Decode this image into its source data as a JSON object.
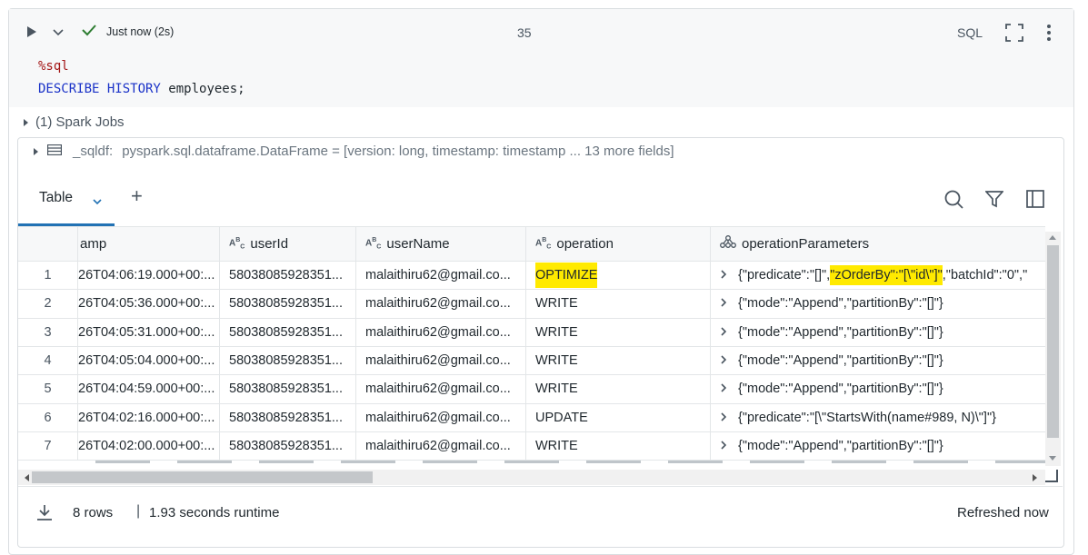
{
  "cell": {
    "status": "Just now (2s)",
    "cell_number": "35",
    "language": "SQL",
    "code_lines": [
      {
        "parts": [
          {
            "t": "%sql",
            "c": "#a31515"
          }
        ]
      },
      {
        "parts": [
          {
            "t": "DESCRIBE HISTORY ",
            "c": "#1a32c8"
          },
          {
            "t": "employees;",
            "c": "#1f272d"
          }
        ]
      }
    ],
    "spark_jobs": "(1) Spark Jobs"
  },
  "dataframe": {
    "var": "_sqldf:",
    "type_text": "pyspark.sql.dataframe.DataFrame = [version: long, timestamp: timestamp ... 13 more fields]"
  },
  "tabs": {
    "table_label": "Table",
    "add": "+"
  },
  "columns": [
    {
      "label": "amp",
      "type": ""
    },
    {
      "label": "userId",
      "type": "ABC"
    },
    {
      "label": "userName",
      "type": "ABC"
    },
    {
      "label": "operation",
      "type": "ABC"
    },
    {
      "label": "operationParameters",
      "type": "STRUCT"
    }
  ],
  "rows": [
    {
      "n": "1",
      "ts": "26T04:06:19.000+00:...",
      "uid": "58038085928351...",
      "uname": "malaithiru62@gmail.co...",
      "op": "OPTIMIZE",
      "params_parts": [
        {
          "t": "{\"predicate\":\"[]\",",
          "hl": false
        },
        {
          "t": "\"zOrderBy\":\"[\\\"id\\\"]\"",
          "hl": true
        },
        {
          "t": ",\"batchId\":\"0\",\"",
          "hl": false
        }
      ],
      "op_hl": true
    },
    {
      "n": "2",
      "ts": "26T04:05:36.000+00:...",
      "uid": "58038085928351...",
      "uname": "malaithiru62@gmail.co...",
      "op": "WRITE",
      "params_parts": [
        {
          "t": "{\"mode\":\"Append\",\"partitionBy\":\"[]\"}",
          "hl": false
        }
      ],
      "op_hl": false
    },
    {
      "n": "3",
      "ts": "26T04:05:31.000+00:...",
      "uid": "58038085928351...",
      "uname": "malaithiru62@gmail.co...",
      "op": "WRITE",
      "params_parts": [
        {
          "t": "{\"mode\":\"Append\",\"partitionBy\":\"[]\"}",
          "hl": false
        }
      ],
      "op_hl": false
    },
    {
      "n": "4",
      "ts": "26T04:05:04.000+00:...",
      "uid": "58038085928351...",
      "uname": "malaithiru62@gmail.co...",
      "op": "WRITE",
      "params_parts": [
        {
          "t": "{\"mode\":\"Append\",\"partitionBy\":\"[]\"}",
          "hl": false
        }
      ],
      "op_hl": false
    },
    {
      "n": "5",
      "ts": "26T04:04:59.000+00:...",
      "uid": "58038085928351...",
      "uname": "malaithiru62@gmail.co...",
      "op": "WRITE",
      "params_parts": [
        {
          "t": "{\"mode\":\"Append\",\"partitionBy\":\"[]\"}",
          "hl": false
        }
      ],
      "op_hl": false
    },
    {
      "n": "6",
      "ts": "26T04:02:16.000+00:...",
      "uid": "58038085928351...",
      "uname": "malaithiru62@gmail.co...",
      "op": "UPDATE",
      "params_parts": [
        {
          "t": "{\"predicate\":\"[\\\"StartsWith(name#989, N)\\\"]\"}",
          "hl": false
        }
      ],
      "op_hl": false
    },
    {
      "n": "7",
      "ts": "26T04:02:00.000+00:...",
      "uid": "58038085928351...",
      "uname": "malaithiru62@gmail.co...",
      "op": "WRITE",
      "params_parts": [
        {
          "t": "{\"mode\":\"Append\",\"partitionBy\":\"[]\"}",
          "hl": false
        }
      ],
      "op_hl": false
    }
  ],
  "footer": {
    "rows": "8 rows",
    "runtime": "1.93 seconds runtime",
    "refreshed": "Refreshed now"
  },
  "colors": {
    "accent": "#2272b4",
    "highlight": "#ffea00",
    "success": "#2e7d32"
  }
}
